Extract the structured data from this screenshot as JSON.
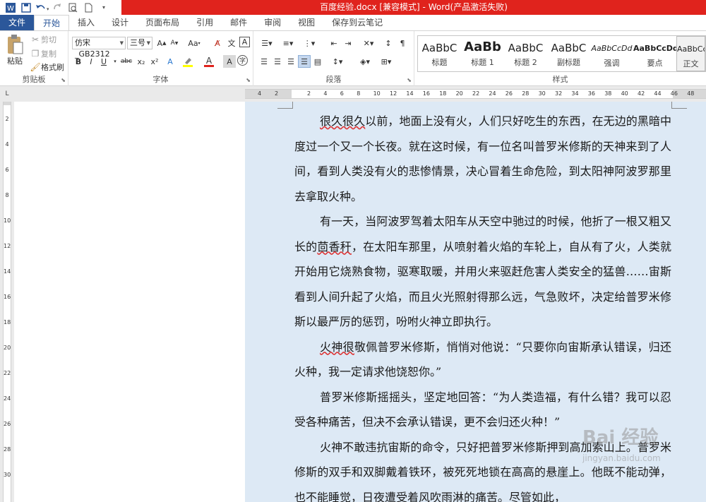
{
  "window": {
    "title": "百度经验.docx [兼容模式] - Word(产品激活失败)"
  },
  "tabs": [
    "文件",
    "开始",
    "插入",
    "设计",
    "页面布局",
    "引用",
    "邮件",
    "审阅",
    "视图",
    "保存到云笔记"
  ],
  "clipboard": {
    "paste_label": "粘贴",
    "cut_label": "剪切",
    "copy_label": "复制",
    "format_painter_label": "格式刷",
    "group_label": "剪贴板"
  },
  "font": {
    "font_name": "仿宋_GB2312",
    "font_size": "三号",
    "grow": "A",
    "shrink": "A",
    "case": "Aa",
    "bold": "B",
    "italic": "I",
    "underline": "U",
    "strike": "abc",
    "subscript": "x₂",
    "superscript": "x²",
    "group_label": "字体"
  },
  "paragraph": {
    "group_label": "段落"
  },
  "styles": {
    "group_label": "样式",
    "items": [
      {
        "sample": "AaBbC",
        "name": "标题"
      },
      {
        "sample": "AaBb",
        "name": "标题 1"
      },
      {
        "sample": "AaBbC",
        "name": "标题 2"
      },
      {
        "sample": "AaBbC",
        "name": "副标题"
      },
      {
        "sample": "AaBbCcDd",
        "name": "强调"
      },
      {
        "sample": "AaBbCcDd",
        "name": "要点"
      },
      {
        "sample": "AaBbCc",
        "name": "正文"
      }
    ]
  },
  "ruler": {
    "corner": "L",
    "h_ticks": [
      "4",
      "2",
      "2",
      "4",
      "6",
      "8",
      "10",
      "12",
      "14",
      "16",
      "18",
      "20",
      "22",
      "24",
      "26",
      "28",
      "30",
      "32",
      "34",
      "36",
      "38",
      "40",
      "42",
      "44",
      "46",
      "48"
    ],
    "v_ticks": [
      "2",
      "4",
      "6",
      "8",
      "10",
      "12",
      "14",
      "16",
      "18",
      "20",
      "22",
      "24",
      "26",
      "28",
      "30"
    ]
  },
  "document": {
    "paragraphs": [
      {
        "squiggle": "很久很久",
        "rest": "以前，地面上没有火，人们只好吃生的东西，在无边的黑暗中度过一个又一个长夜。就在这时候，有一位名叫普罗米修斯的天神来到了人间，看到人类没有火的悲惨情景，决心冒着生命危险，到太阳神阿波罗那里去拿取火种。"
      },
      {
        "before": "有一天，当阿波罗驾着太阳车从天空中驰过的时候，他折了一根又粗又长的",
        "squiggle": "茴香秆",
        "rest": "，在太阳车那里，从喷射着火焰的车轮上，自从有了火，人类就开始用它烧熟食物，驱寒取暖，并用火来驱赶危害人类安全的猛兽……宙斯看到人间升起了火焰，而且火光照射得那么远，气急败坏，决定给普罗米修斯以最严厉的惩罚，吩咐火神立即执行。"
      },
      {
        "squiggle": "火神很",
        "rest": "敬佩普罗米修斯，悄悄对他说：“只要你向宙斯承认错误，归还火种，我一定请求他饶恕你。”"
      },
      {
        "rest": "普罗米修斯摇摇头，坚定地回答：“为人类造福，有什么错？我可以忍受各种痛苦，但决不会承认错误，更不会归还火种！”"
      },
      {
        "rest": "火神不敢违抗宙斯的命令，只好把普罗米修斯押到高加索山上。普罗米修斯的双手和双脚戴着铁环，被死死地锁在高高的悬崖上。他既不能动弹，也不能睡觉，日夜遭受着风吹雨淋的痛苦。尽管如此，"
      }
    ]
  },
  "watermark": {
    "brand": "Bai 经验",
    "url": "jingyan.baidu.com"
  }
}
